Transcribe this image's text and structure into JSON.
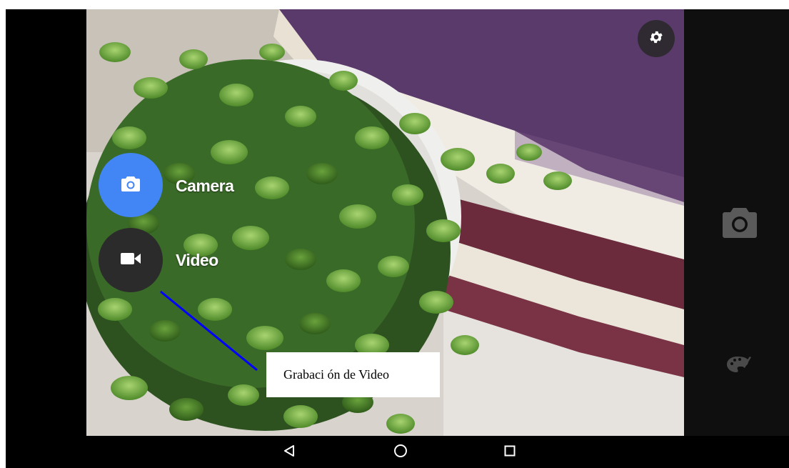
{
  "mode_menu": {
    "items": [
      {
        "label": "Camera",
        "icon": "camera-icon",
        "color": "#4285f4"
      },
      {
        "label": "Video",
        "icon": "videocam-icon",
        "color": "#2b2b2b"
      }
    ]
  },
  "annotation": {
    "text": "Grabaci ón de Video"
  },
  "toolbar": {
    "settings_icon": "gear-icon",
    "shutter_icon": "camera-shutter-icon",
    "filter_icon": "palette-icon"
  },
  "navigation": {
    "back_icon": "back-triangle-icon",
    "home_icon": "home-circle-icon",
    "recents_icon": "recents-square-icon"
  },
  "colors": {
    "accent": "#4285f4",
    "panel": "#0f0f0f"
  }
}
